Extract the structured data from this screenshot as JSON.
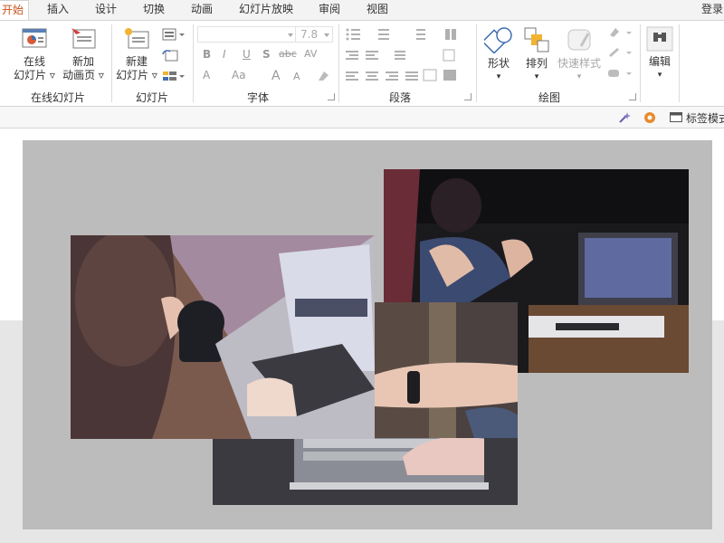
{
  "tabs": [
    "开始",
    "插入",
    "设计",
    "切换",
    "动画",
    "幻灯片放映",
    "审阅",
    "视图"
  ],
  "login": "登录",
  "groups": {
    "online": {
      "label": "在线幻灯片",
      "btn1": [
        "在线",
        "幻灯片 ▿"
      ],
      "btn2": [
        "新加",
        "动画页 ▿"
      ]
    },
    "slides": {
      "label": "幻灯片",
      "btn": [
        "新建",
        "幻灯片 ▿"
      ]
    },
    "font": {
      "label": "字体",
      "size": "7.8",
      "bold": "B",
      "italic": "I",
      "underline": "U",
      "shadow": "S",
      "strike": "abc",
      "spacing": "AV",
      "color": "A",
      "case": "Aa",
      "grow": "A",
      "shrink": "A"
    },
    "paragraph": {
      "label": "段落"
    },
    "drawing": {
      "label": "绘图",
      "shape": "形状",
      "arrange": "排列",
      "quick": "快速样式"
    },
    "editing": {
      "label": "编辑"
    }
  },
  "subbar": {
    "label": "标签模式"
  },
  "colors": {
    "accent": "#c8511b",
    "slideBg": "#bcbcbc"
  }
}
